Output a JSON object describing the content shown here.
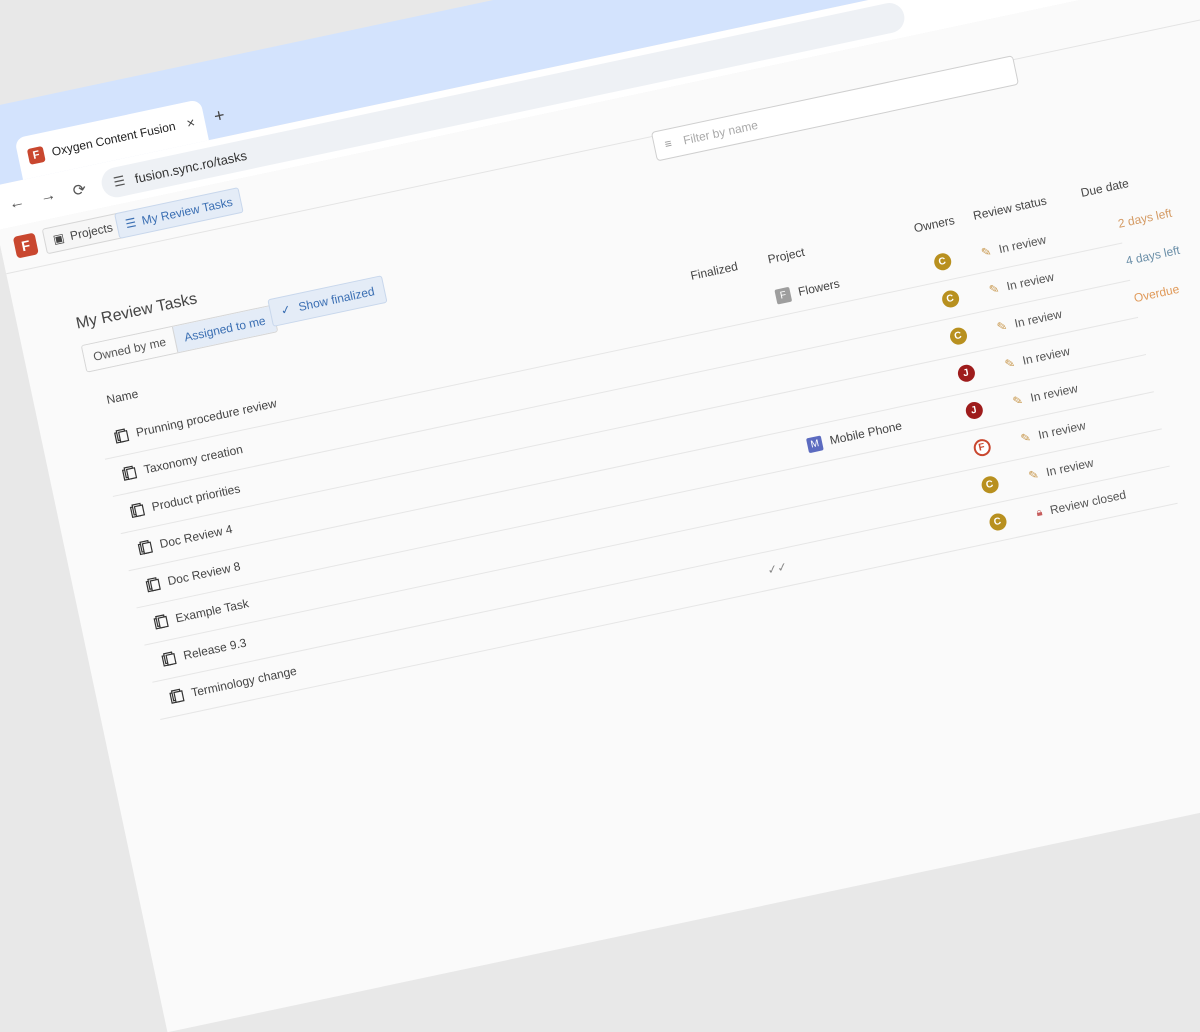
{
  "browser": {
    "tab_title": "Oxygen Content Fusion",
    "tab_close": "×",
    "new_tab": "+",
    "url": "fusion.sync.ro/tasks",
    "back": "←",
    "forward": "→",
    "reload": "⟳"
  },
  "app": {
    "logo_letter": "F",
    "projects_label": "Projects",
    "my_review_tasks_label": "My Review Tasks",
    "filter_placeholder": "Filter by name",
    "page_title": "My Review Tasks",
    "segment": {
      "owned": "Owned by me",
      "assigned": "Assigned to me"
    },
    "show_finalized": "Show finalized"
  },
  "table": {
    "headers": {
      "name": "Name",
      "finalized": "Finalized",
      "project": "Project",
      "owners": "Owners",
      "review_status": "Review status",
      "due_date": "Due date"
    },
    "rows": [
      {
        "name": "Prunning procedure review",
        "finalized": "",
        "project_letter": "F",
        "project": "Flowers",
        "project_color": "#9e9e9e",
        "owner": "C",
        "owner_color": "#b8901f",
        "status": "In review",
        "status_icon": "pencil",
        "due": "2 days left",
        "due_color": "#d49a63"
      },
      {
        "name": "Taxonomy creation",
        "finalized": "",
        "project_letter": "",
        "project": "",
        "project_color": "",
        "owner": "C",
        "owner_color": "#b8901f",
        "status": "In review",
        "status_icon": "pencil",
        "due": "4 days left",
        "due_color": "#6b8fa8"
      },
      {
        "name": "Product priorities",
        "finalized": "",
        "project_letter": "",
        "project": "",
        "project_color": "",
        "owner": "C",
        "owner_color": "#b8901f",
        "status": "In review",
        "status_icon": "pencil",
        "due": "Overdue",
        "due_color": "#e09a5a"
      },
      {
        "name": "Doc Review 4",
        "finalized": "",
        "project_letter": "",
        "project": "",
        "project_color": "",
        "owner": "J",
        "owner_color": "#9e1c1c",
        "status": "In review",
        "status_icon": "pencil",
        "due": "",
        "due_color": ""
      },
      {
        "name": "Doc Review 8",
        "finalized": "",
        "project_letter": "M",
        "project": "Mobile Phone",
        "project_color": "#5c6bc0",
        "owner": "J",
        "owner_color": "#9e1c1c",
        "status": "In review",
        "status_icon": "pencil",
        "due": "",
        "due_color": ""
      },
      {
        "name": "Example Task",
        "finalized": "",
        "project_letter": "",
        "project": "",
        "project_color": "",
        "owner": "F",
        "owner_color": "#c9472f",
        "status": "In review",
        "status_icon": "pencil",
        "due": "",
        "due_color": ""
      },
      {
        "name": "Release 9.3",
        "finalized": "",
        "project_letter": "",
        "project": "",
        "project_color": "",
        "owner": "C",
        "owner_color": "#b8901f",
        "status": "In review",
        "status_icon": "pencil",
        "due": "",
        "due_color": ""
      },
      {
        "name": "Terminology change",
        "finalized": "✓✓",
        "project_letter": "",
        "project": "",
        "project_color": "",
        "owner": "C",
        "owner_color": "#b8901f",
        "status": "Review closed",
        "status_icon": "lock",
        "due": "",
        "due_color": ""
      }
    ]
  }
}
